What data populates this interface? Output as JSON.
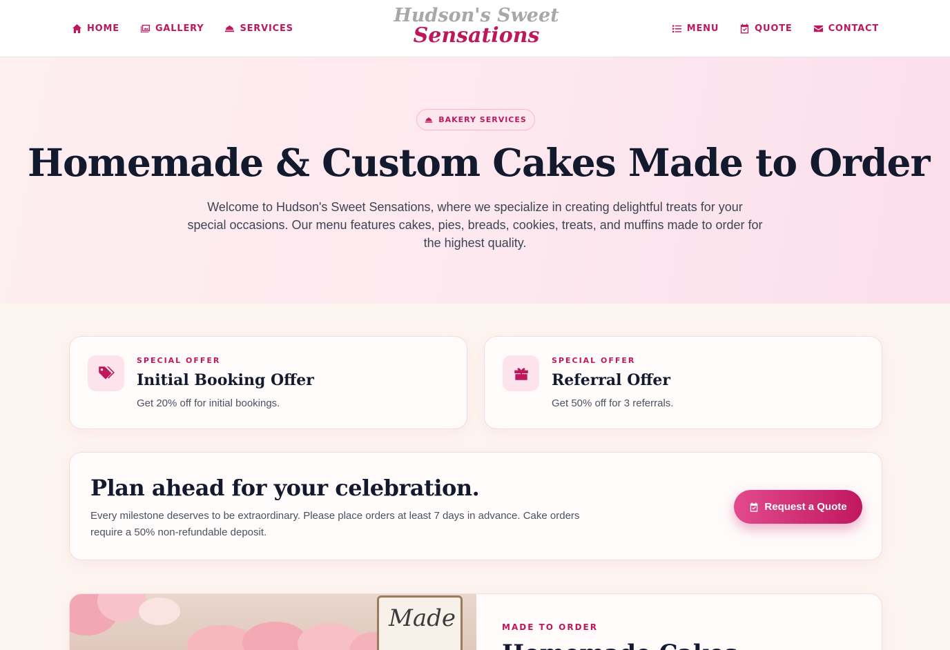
{
  "brand": {
    "line1": "Hudson's Sweet",
    "line2": "Sensations",
    "accent_color": "#be185d"
  },
  "nav": {
    "left": [
      {
        "label": "HOME",
        "icon": "home-icon"
      },
      {
        "label": "GALLERY",
        "icon": "gallery-icon"
      },
      {
        "label": "SERVICES",
        "icon": "cloche-icon"
      }
    ],
    "right": [
      {
        "label": "MENU",
        "icon": "list-icon"
      },
      {
        "label": "QUOTE",
        "icon": "calendar-check-icon"
      },
      {
        "label": "CONTACT",
        "icon": "envelope-icon"
      }
    ]
  },
  "hero": {
    "badge": "BAKERY SERVICES",
    "title": "Homemade & Custom Cakes Made to Order",
    "subtitle": "Welcome to Hudson's Sweet Sensations, where we specialize in creating delightful treats for your special occasions. Our menu features cakes, pies, breads, cookies, treats, and muffins made to order for the highest quality."
  },
  "offers": [
    {
      "kicker": "SPECIAL OFFER",
      "title": "Initial Booking Offer",
      "description": "Get 20% off for initial bookings.",
      "icon": "tags-icon"
    },
    {
      "kicker": "SPECIAL OFFER",
      "title": "Referral Offer",
      "description": "Get 50% off for 3 referrals.",
      "icon": "gift-icon"
    }
  ],
  "plan": {
    "title": "Plan ahead for your celebration.",
    "description": "Every milestone deserves to be extraordinary. Please place orders at least 7 days in advance. Cake orders require a 50% non-refundable deposit.",
    "button_label": "Request a Quote",
    "button_icon": "calendar-check-icon"
  },
  "feature": {
    "kicker": "MADE TO ORDER",
    "title": "Homemade Cakes",
    "sign_text": "Made"
  }
}
